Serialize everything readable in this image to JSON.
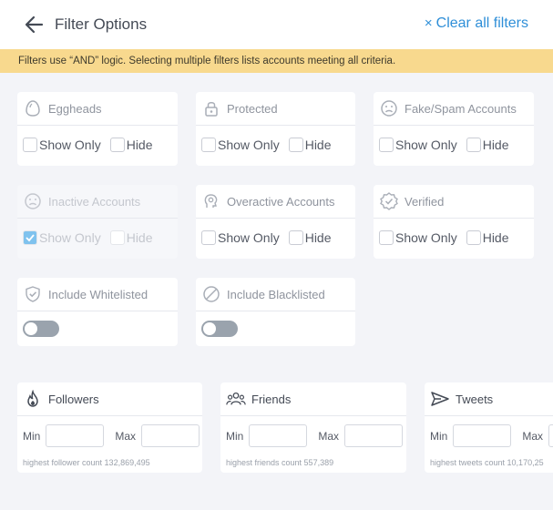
{
  "header": {
    "title": "Filter Options",
    "clear_label": "Clear all filters"
  },
  "banner": {
    "text": "Filters use “AND” logic. Selecting multiple filters lists accounts meeting all criteria."
  },
  "options": {
    "show_only": "Show Only",
    "hide": "Hide"
  },
  "filters": [
    {
      "label": "Eggheads",
      "icon": "egg-icon",
      "show_only": false,
      "hide": false,
      "disabled": false
    },
    {
      "label": "Protected",
      "icon": "lock-icon",
      "show_only": false,
      "hide": false,
      "disabled": false
    },
    {
      "label": "Fake/Spam Accounts",
      "icon": "sad-face-icon",
      "show_only": false,
      "hide": false,
      "disabled": false
    },
    {
      "label": "Inactive Accounts",
      "icon": "sad-face-icon",
      "show_only": true,
      "hide": false,
      "disabled": true
    },
    {
      "label": "Overactive Accounts",
      "icon": "brain-gear-icon",
      "show_only": false,
      "hide": false,
      "disabled": false
    },
    {
      "label": "Verified",
      "icon": "verified-badge-icon",
      "show_only": false,
      "hide": false,
      "disabled": false
    }
  ],
  "toggles": [
    {
      "label": "Include Whitelisted",
      "icon": "shield-check-icon",
      "on": false
    },
    {
      "label": "Include Blacklisted",
      "icon": "ban-icon",
      "on": false
    }
  ],
  "ranges": [
    {
      "label": "Followers",
      "icon": "flame-icon",
      "min_label": "Min",
      "max_label": "Max",
      "hint": "highest follower count 132,869,495"
    },
    {
      "label": "Friends",
      "icon": "group-icon",
      "min_label": "Min",
      "max_label": "Max",
      "hint": "highest friends count 557,389"
    },
    {
      "label": "Tweets",
      "icon": "send-icon",
      "min_label": "Min",
      "max_label": "Max",
      "hint": "highest tweets count 10,170,25"
    }
  ],
  "colors": {
    "accent": "#2f8fd8",
    "banner": "#f8d98e",
    "toggle_off": "#9aa3ad",
    "checked": "#7fc2ee"
  }
}
